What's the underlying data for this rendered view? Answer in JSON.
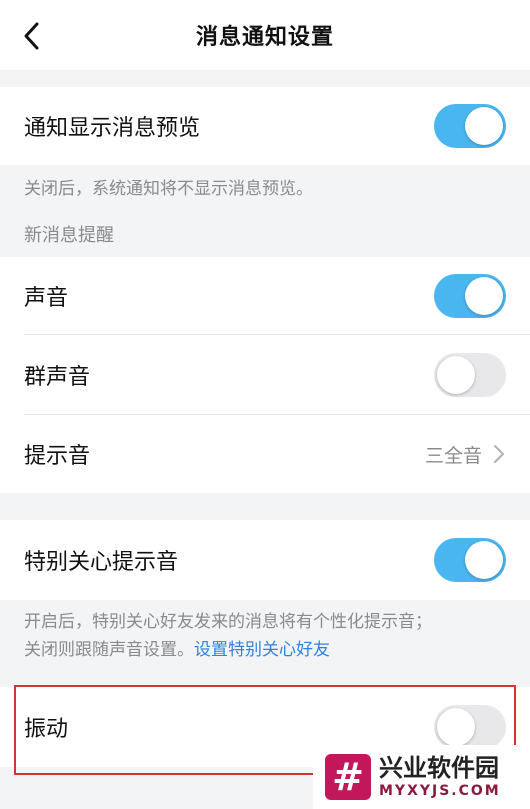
{
  "header": {
    "title": "消息通知设置",
    "back_icon": "chevron-left-icon"
  },
  "preview": {
    "label": "通知显示消息预览",
    "toggle": "on",
    "note": "关闭后，系统通知将不显示消息预览。"
  },
  "new_message": {
    "section_title": "新消息提醒",
    "sound": {
      "label": "声音",
      "toggle": "on"
    },
    "group_sound": {
      "label": "群声音",
      "toggle": "off"
    },
    "tone": {
      "label": "提示音",
      "value": "三全音"
    }
  },
  "special": {
    "label": "特别关心提示音",
    "toggle": "on",
    "note_line1": "开启后，特别关心好友发来的消息将有个性化提示音；",
    "note_line2": "关闭则跟随声音设置。",
    "note_link": "设置特别关心好友"
  },
  "vibration": {
    "label": "振动",
    "toggle": "off"
  },
  "watermark": {
    "logo": "#",
    "name": "兴业软件园",
    "site": "MYXYJS.COM"
  },
  "colors": {
    "accent": "#4ab6f0",
    "link": "#2f82e3",
    "highlight": "#d8342f",
    "watermark": "#c2185b"
  }
}
